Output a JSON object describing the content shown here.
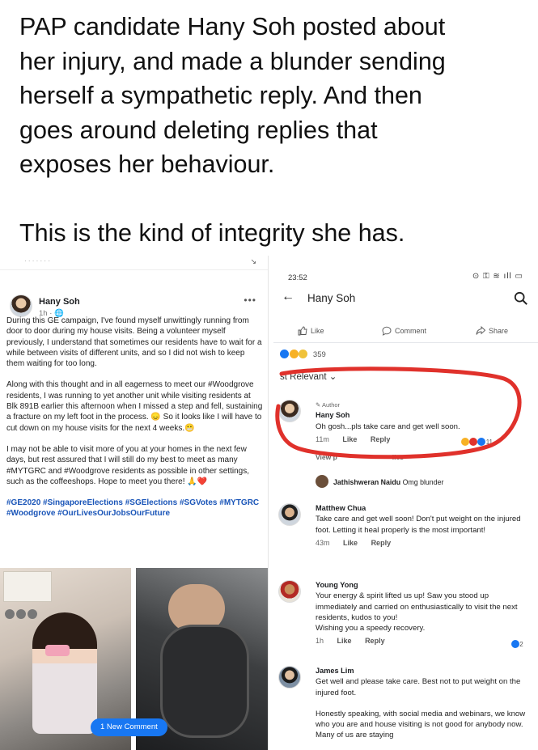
{
  "headline": {
    "line1": "PAP candidate Hany Soh posted about",
    "line2": "her injury, and made a blunder sending",
    "line3": "herself a sympathetic reply. And then",
    "line4": "goes around deleting replies that",
    "line5": "exposes her behaviour.",
    "line6": "This is the kind of integrity she has."
  },
  "left_post": {
    "author": "Hany Soh",
    "meta": "1h · 🌐",
    "menu_icon": "more-dots-icon",
    "paragraphs": [
      "During this GE campaign, I've found myself unwittingly running from door to door during my house visits. Being a volunteer myself previously, I understand that sometimes our residents have to wait for a while between visits of different units, and so I did not wish to keep them waiting for too long.",
      "Along with this thought and in all eagerness to meet our #Woodgrove residents, I was running to yet another unit while visiting residents at Blk 891B earlier this afternoon when I missed a step and fell, sustaining a fracture on my left foot in the process. 😞 So it looks like I will have to cut down on my house visits for the next 4 weeks.😬",
      "I may not be able to visit more of you at your homes in the next few days, but rest assured that I will still do my best to meet as many #MYTGRC and #Woodgrove residents as possible in other settings, such as the coffeeshops. Hope to meet you there! 🙏❤️"
    ],
    "hashtags": "#GE2020 #SingaporeElections #SGElections #SGVotes #MYTGRC #Woodgrove #OurLivesOurJobsOurFuture",
    "new_comment_label": "1 New Comment"
  },
  "right_panel": {
    "status_time": "23:52",
    "status_icons": "⊙ ⚿ ≋ ıll ▭",
    "nav_title": "Hany Soh",
    "actions": {
      "like": "Like",
      "comment": "Comment",
      "share": "Share"
    },
    "reaction_count": "359",
    "relevant_label": "st Relevant ⌄",
    "comments": [
      {
        "badge": "✎ Author",
        "name": "Hany Soh",
        "text": "Oh gosh...pls take care and get well soon.",
        "time": "11m",
        "like": "Like",
        "reply": "Reply",
        "reactions": "11"
      },
      {
        "name": "Matthew Chua",
        "text": "Take care and get well soon! Don't put weight on the injured foot. Letting it heal properly is the most important!",
        "time": "43m",
        "like": "Like",
        "reply": "Reply"
      },
      {
        "name": "Young Yong",
        "text": "Your energy & spirit lifted us up! Saw you stood up immediately and carried on enthusiastically to visit the next residents, kudos to you!",
        "text2": "Wishing you a speedy recovery.",
        "time": "1h",
        "like": "Like",
        "reply": "Reply",
        "reactions": "2"
      },
      {
        "name": "James Lim",
        "text": "Get well and please take care. Best not to put weight on the injured foot.",
        "text2": "Honestly speaking, with social media and webinars, we know who you are and house visiting is not good for anybody now. Many of us are staying"
      }
    ],
    "view_previous": "View p",
    "view_previous_tail": "lies",
    "sub_reply": {
      "name": "Jathishweran Naidu",
      "text": "Omg blunder"
    }
  },
  "colors": {
    "link_blue": "#1a55b8",
    "fb_blue": "#1877f2",
    "annotation_red": "#e0312b"
  }
}
